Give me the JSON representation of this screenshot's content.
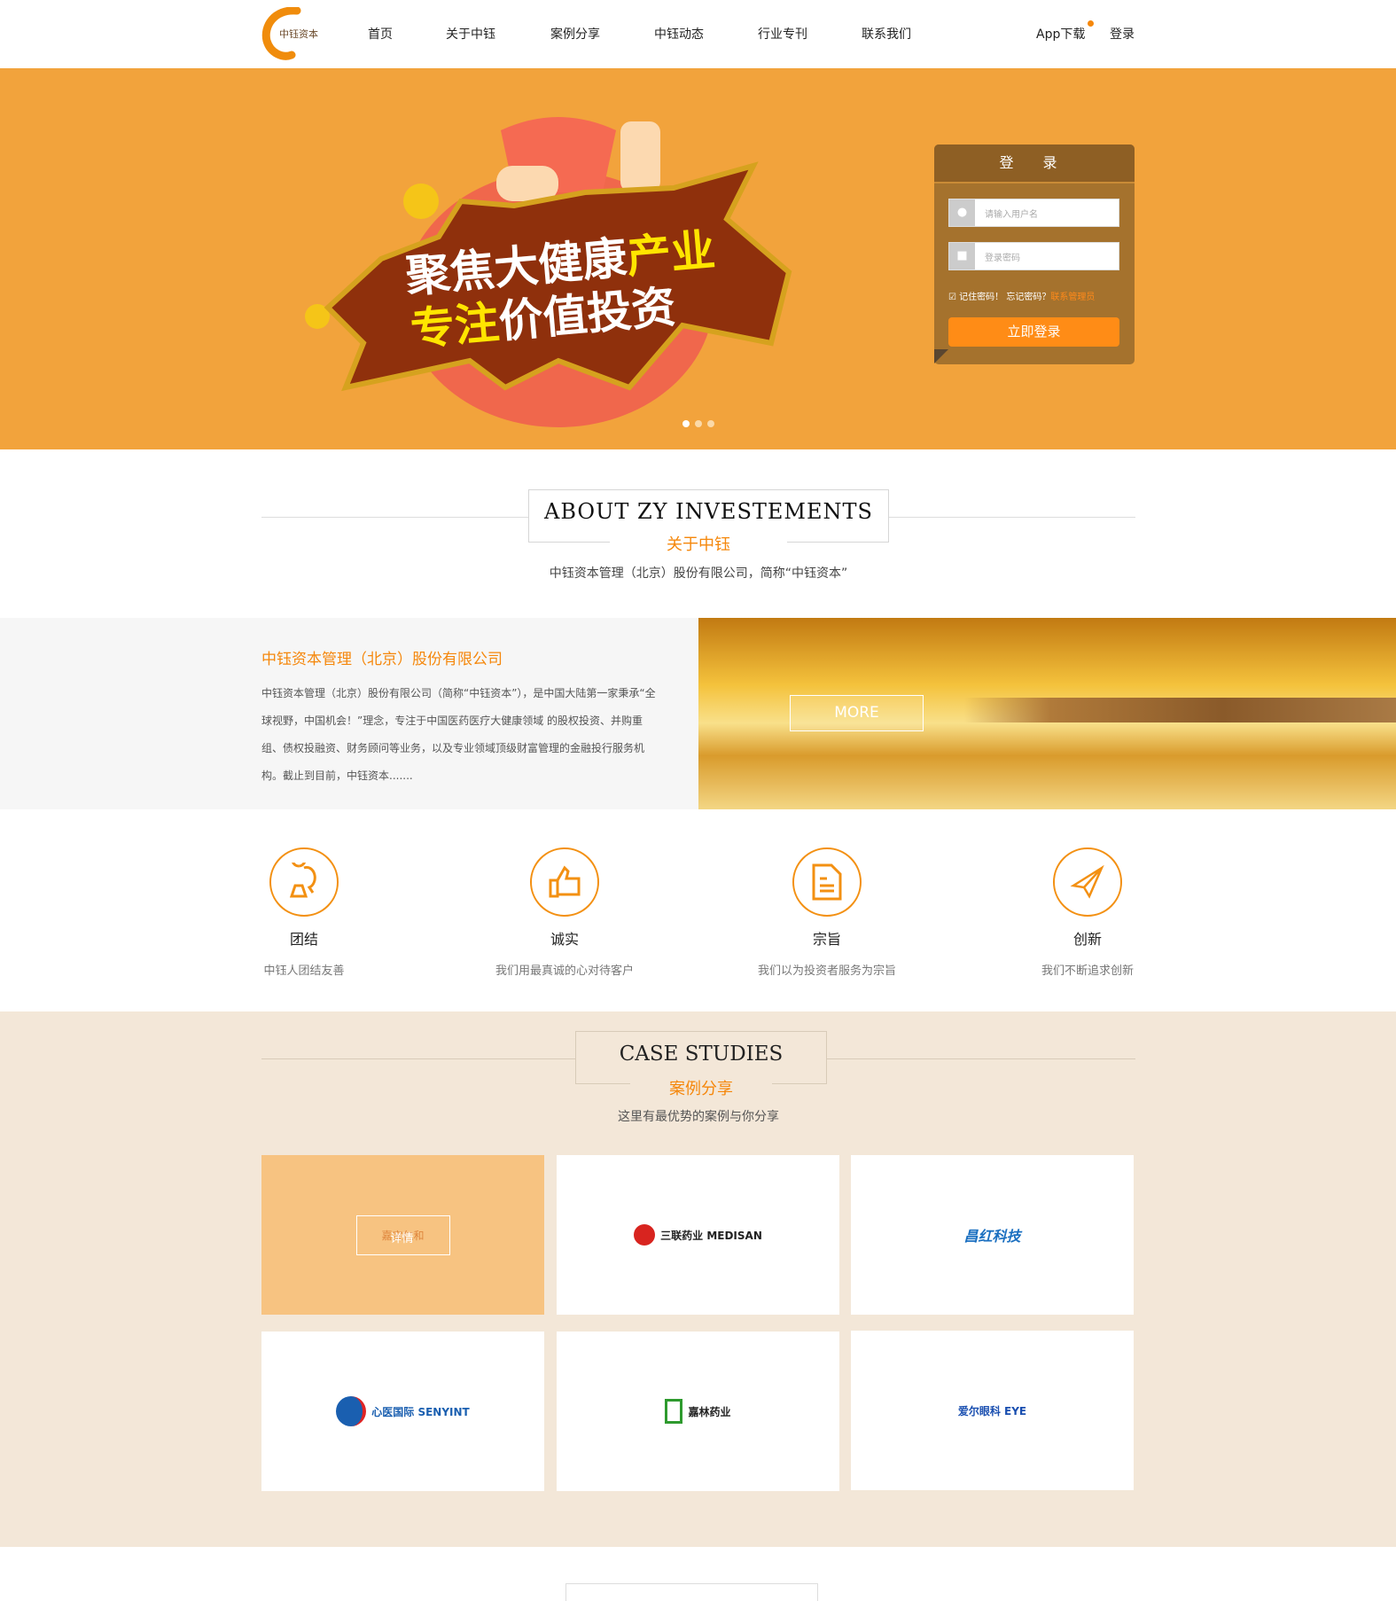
{
  "header": {
    "logo_text": "中钰资本",
    "nav": [
      "首页",
      "关于中钰",
      "案例分享",
      "中钰动态",
      "行业专刊",
      "联系我们"
    ],
    "app_download": "App下载",
    "login": "登录"
  },
  "banner": {
    "line1_white": "聚焦大健康",
    "line1_yellow": "产业",
    "line2_yellow": "专注",
    "line2_white": "价值投资",
    "slides": 3,
    "active_slide": 1
  },
  "login_box": {
    "title": "登 录",
    "username_placeholder": "请输入用户名",
    "password_placeholder": "登录密码",
    "remember": "记住密码！",
    "forgot": "忘记密码？",
    "contact_admin": "联系管理员",
    "submit": "立即登录",
    "remember_checked": true
  },
  "about": {
    "title_en": "ABOUT ZY INVESTEMENTS",
    "title_cn": "关于中钰",
    "desc": "中钰资本管理（北京）股份有限公司，简称“中钰资本”"
  },
  "intro": {
    "heading": "中钰资本管理（北京）股份有限公司",
    "body": "中钰资本管理（北京）股份有限公司（简称“中钰资本”），是中国大陆第一家秉承“全球视野，中国机会！”理念，专注于中国医药医疗大健康领域 的股权投资、并购重组、债权投融资、财务顾问等业务，以及专业领域顶级财富管理的金融投行服务机构。截止到目前，中钰资本.......",
    "more": "MORE"
  },
  "values": [
    {
      "icon": "users-icon",
      "title": "团结",
      "desc": "中钰人团结友善"
    },
    {
      "icon": "thumbs-up-icon",
      "title": "诚实",
      "desc": "我们用最真诚的心对待客户"
    },
    {
      "icon": "document-icon",
      "title": "宗旨",
      "desc": "我们以为投资者服务为宗旨"
    },
    {
      "icon": "paper-plane-icon",
      "title": "创新",
      "desc": "我们不断追求创新"
    }
  ],
  "cases": {
    "title_en": "CASE STUDIES",
    "title_cn": "案例分享",
    "desc": "这里有最优势的案例与你分享",
    "detail_label": "详情",
    "items": [
      {
        "name": "嘉宝仁和",
        "color": "#d9762c"
      },
      {
        "name": "三联药业 MEDISAN",
        "color": "#d8241f"
      },
      {
        "name": "昌红科技",
        "color": "#1a6fc0"
      },
      {
        "name": "心医国际 SENYINT",
        "color": "#1a5fb0"
      },
      {
        "name": "嘉林药业",
        "color": "#2e9a2e"
      },
      {
        "name": "爱尔眼科 EYE",
        "color": "#1a4fb0"
      }
    ]
  },
  "colors": {
    "accent": "#f5870b",
    "banner": "#f2a33c",
    "cases_bg": "#f3e7d8",
    "login_bg": "#a5722d"
  }
}
